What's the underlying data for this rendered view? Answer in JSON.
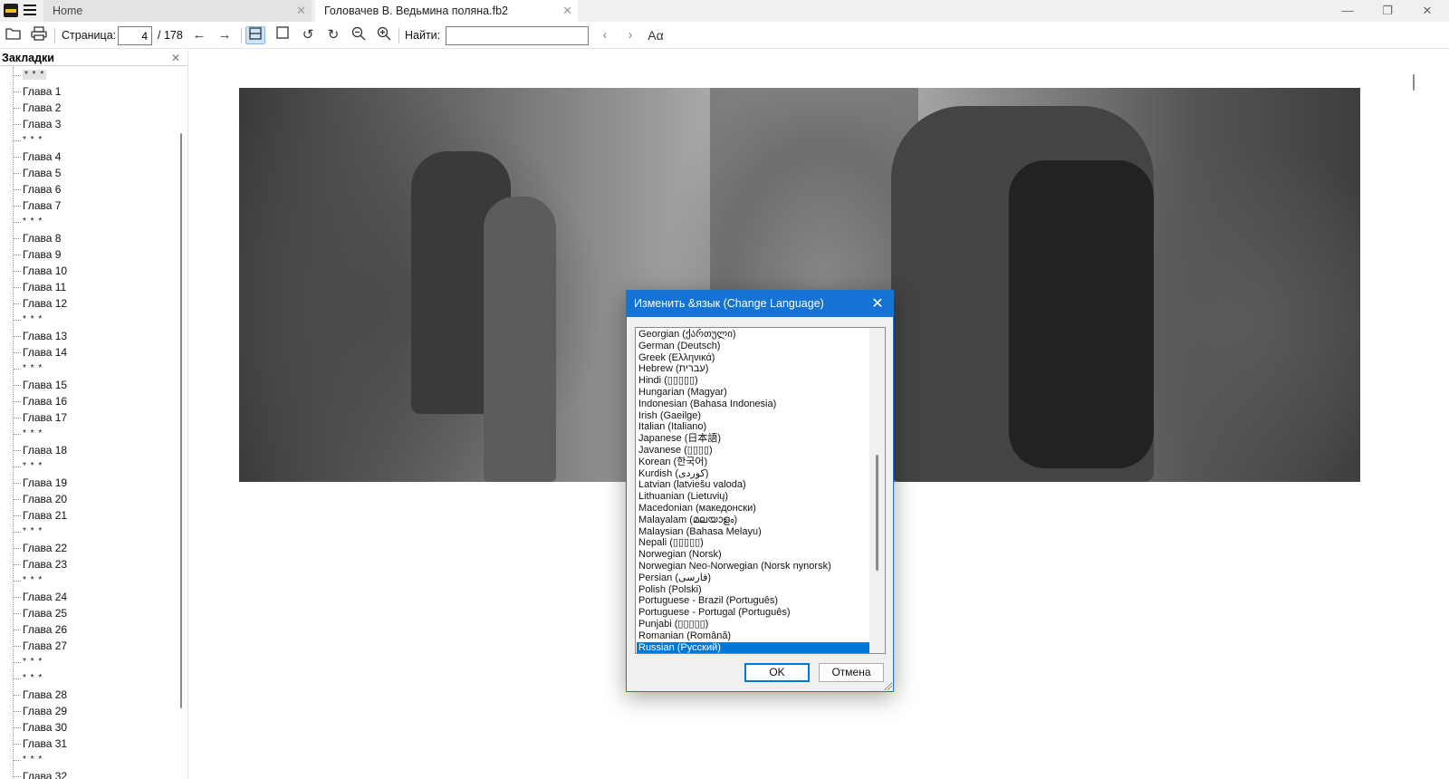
{
  "tabs": {
    "home_label": "Home",
    "doc_label": "Головачев В. Ведьмина поляна.fb2"
  },
  "toolbar": {
    "page_label": "Страница:",
    "page_current": "4",
    "page_total": "/ 178",
    "find_label": "Найти:",
    "find_value": ""
  },
  "bookmarks": {
    "title": "Закладки",
    "items": [
      "* * *",
      "Глава 1",
      "Глава 2",
      "Глава 3",
      "* * *",
      "Глава 4",
      "Глава 5",
      "Глава 6",
      "Глава 7",
      "* * *",
      "Глава 8",
      "Глава 9",
      "Глава 10",
      "Глава 11",
      "Глава 12",
      "* * *",
      "Глава 13",
      "Глава 14",
      "* * *",
      "Глава 15",
      "Глава 16",
      "Глава 17",
      "* * *",
      "Глава 18",
      "* * *",
      "Глава 19",
      "Глава 20",
      "Глава 21",
      "* * *",
      "Глава 22",
      "Глава 23",
      "* * *",
      "Глава 24",
      "Глава 25",
      "Глава 26",
      "Глава 27",
      "* * *",
      "* * *",
      "Глава 28",
      "Глава 29",
      "Глава 30",
      "Глава 31",
      "* * *",
      "Глава 32"
    ]
  },
  "dialog": {
    "title": "Изменить &язык (Change Language)",
    "languages": [
      "Georgian (ქართული)",
      "German (Deutsch)",
      "Greek (Ελληνικά)",
      "Hebrew (עברית)",
      "Hindi (▯▯▯▯▯)",
      "Hungarian (Magyar)",
      "Indonesian (Bahasa Indonesia)",
      "Irish (Gaeilge)",
      "Italian (Italiano)",
      "Japanese (日本語)",
      "Javanese (▯▯▯▯)",
      "Korean (한국어)",
      "Kurdish (کوردی)",
      "Latvian (latviešu valoda)",
      "Lithuanian (Lietuvių)",
      "Macedonian (македонски)",
      "Malayalam (മലയാളം)",
      "Malaysian (Bahasa Melayu)",
      "Nepali (▯▯▯▯▯)",
      "Norwegian (Norsk)",
      "Norwegian Neo-Norwegian (Norsk nynorsk)",
      "Persian (فارسی)",
      "Polish (Polski)",
      "Portuguese - Brazil (Português)",
      "Portuguese - Portugal (Português)",
      "Punjabi (▯▯▯▯▯)",
      "Romanian (Română)",
      "Russian (Русский)"
    ],
    "selected_language": "Russian (Русский)",
    "ok_label": "OK",
    "cancel_label": "Отмена"
  },
  "colors": {
    "accent": "#1473d4",
    "selection": "#0078d7"
  }
}
